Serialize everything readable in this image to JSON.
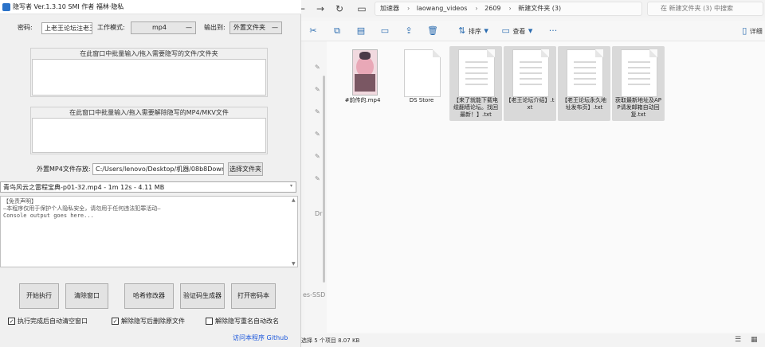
{
  "explorer": {
    "nav": {
      "back": "←",
      "forward": "→",
      "up": "↑",
      "refresh": "↻",
      "monitor": "▭"
    },
    "breadcrumbs": [
      "加速器",
      "laowang_videos",
      "2609",
      "新建文件夹 (3)"
    ],
    "search_placeholder": "在 新建文件夹 (3) 中搜索",
    "toolbar": {
      "cut": "✂",
      "copy": "⧉",
      "paste": "▤",
      "rename": "▭",
      "share": "⇪",
      "delete": "🗑",
      "sort_label": "排序",
      "view_label": "查看",
      "more": "···",
      "details_label": "详细"
    },
    "files": [
      {
        "name": "#前传的.mp4",
        "kind": "video",
        "selected": false
      },
      {
        "name": "DS Store",
        "kind": "blank",
        "selected": false
      },
      {
        "name": "【来了就能下载电缆翻墙论坛。找回最新！】.txt",
        "kind": "text",
        "selected": true
      },
      {
        "name": "【老王论坛介绍】.txt",
        "kind": "text",
        "selected": true
      },
      {
        "name": "【老王论坛永久地址发布页】.txt",
        "kind": "text",
        "selected": true
      },
      {
        "name": "获取最新地址及APP请发邮箱自动回复.txt",
        "kind": "text",
        "selected": true
      }
    ],
    "sidebar_fragments": [
      "Dr",
      "es-SSD"
    ],
    "status": "选择 5 个项目  8.07 KB"
  },
  "tool": {
    "title": "隐写者 Ver.1.3.10 SMI 作者 福林·隐私",
    "password_label": "密码:",
    "password_value": "上老王论坛注老王",
    "mode_label": "工作模式:",
    "mode_value": "mp4",
    "output_label": "输出到:",
    "output_value": "外置文件夹",
    "drop1_label": "在此窗口中批量输入/拖入需要隐写的文件/文件夹",
    "drop2_label": "在此窗口中批量输入/拖入需要解除隐写的MP4/MKV文件",
    "outer_label": "外置MP4文件存放:",
    "outer_path": "C:/Users/lenovo/Desktop/机器/08b8Dowr",
    "choose_btn": "选择文件夹",
    "selected_file": "青鸟风云之雷程宝典-p01-32.mp4 - 1m 12s - 4.11 MB",
    "console_lines": [
      "【免责声明】",
      "—本程序仅用于保护个人隐私安全，请勿用于任何违法犯罪活动—",
      "Console output goes here..."
    ],
    "buttons": [
      "开始执行",
      "清除窗口",
      "哈希修改器",
      "验证码生成器",
      "打开密码本"
    ],
    "checkboxes": [
      {
        "label": "执行完成后自动清空窗口",
        "checked": true
      },
      {
        "label": "解除隐写后删除原文件",
        "checked": true
      },
      {
        "label": "解除隐写重名自动改名",
        "checked": false
      }
    ],
    "check_mark": "✓",
    "footer_link": "访问本程序 Github"
  }
}
